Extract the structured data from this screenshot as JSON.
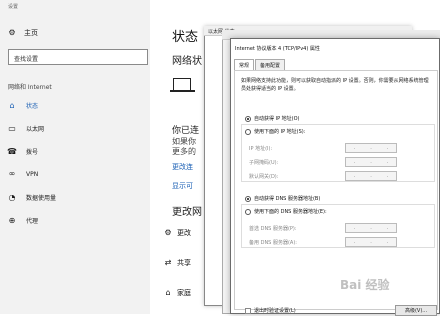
{
  "settings": {
    "window_title": "设置",
    "home": "主页",
    "search_placeholder": "查找设置",
    "section": "网络和 Internet",
    "nav": [
      {
        "label": "状态",
        "icon": "home-status-icon",
        "active": true
      },
      {
        "label": "以太网",
        "icon": "monitor-icon",
        "active": false
      },
      {
        "label": "拨号",
        "icon": "phone-icon",
        "active": false
      },
      {
        "label": "VPN",
        "icon": "vpn-icon",
        "active": false
      },
      {
        "label": "数据使用量",
        "icon": "data-usage-icon",
        "active": false
      },
      {
        "label": "代理",
        "icon": "globe-icon",
        "active": false
      }
    ]
  },
  "main": {
    "title": "状态",
    "network_status": "网络状",
    "text1": "你已连",
    "text2": "如果你",
    "text3": "更多的",
    "link1": "更改连",
    "link2": "显示可",
    "change_heading": "更改网",
    "options": [
      {
        "label": "更改",
        "icon": "adapter-icon"
      },
      {
        "label": "共享",
        "icon": "sharing-icon"
      },
      {
        "label": "家庭",
        "icon": "homegroup-icon"
      }
    ]
  },
  "win2": {
    "title": "以太网 状态"
  },
  "dialog": {
    "title": "Internet 协议版本 4 (TCP/IPv4) 属性",
    "tabs": [
      "常规",
      "备用配置"
    ],
    "desc": "如果网络支持此功能，则可以获取自动指派的 IP 设置。否则，你需要从网络系统管理员处获得适当的 IP 设置。",
    "auto_ip": "自动获得 IP 地址(O)",
    "manual_ip": "使用下面的 IP 地址(S):",
    "ip_label": "IP 地址(I):",
    "mask_label": "子网掩码(U):",
    "gateway_label": "默认网关(D):",
    "auto_dns": "自动获得 DNS 服务器地址(B)",
    "manual_dns": "使用下面的 DNS 服务器地址(E):",
    "pref_dns_label": "首选 DNS 服务器(P):",
    "alt_dns_label": "备用 DNS 服务器(A):",
    "validate": "退出时验证设置(L)",
    "advanced": "高级(V)..."
  },
  "watermark": "Bai 经验"
}
